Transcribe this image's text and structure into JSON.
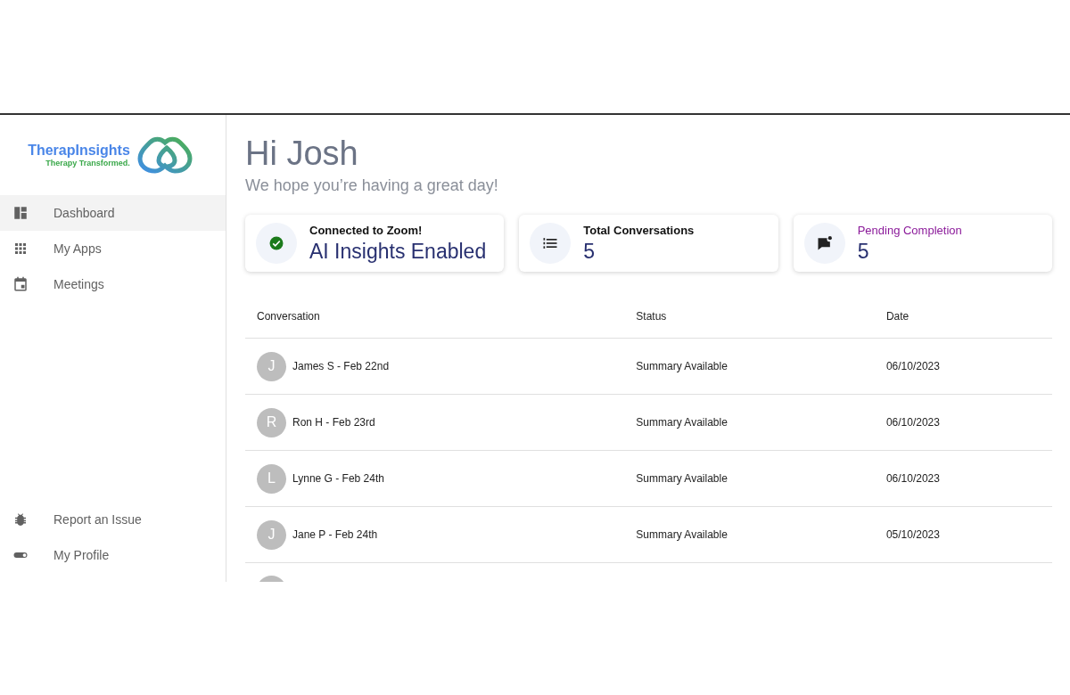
{
  "logo": {
    "name": "TherapInsights",
    "tagline": "Therapy Transformed."
  },
  "nav": [
    {
      "label": "Dashboard",
      "kind": "dashboard",
      "selected": true
    },
    {
      "label": "My Apps",
      "kind": "apps",
      "selected": false
    },
    {
      "label": "Meetings",
      "kind": "calendar",
      "selected": false
    }
  ],
  "nav_bottom": [
    {
      "label": "Report an Issue",
      "kind": "bug",
      "selected": false
    },
    {
      "label": "My Profile",
      "kind": "toggle",
      "selected": false
    }
  ],
  "greeting": {
    "title": "Hi Josh",
    "subtitle": "We hope you’re having a great day!"
  },
  "cards": [
    {
      "kind": "status",
      "title": "Connected to Zoom!",
      "value": "AI Insights Enabled",
      "highlighted": false
    },
    {
      "kind": "list",
      "title": "Total Conversations",
      "value": "5",
      "highlighted": false
    },
    {
      "kind": "flag",
      "title": "Pending Completion",
      "value": "5",
      "highlighted": true
    }
  ],
  "table": {
    "columns": [
      "Conversation",
      "Status",
      "Date"
    ],
    "rows": [
      {
        "initial": "J",
        "conversation": "James S - Feb 22nd",
        "status": "Summary Available",
        "date": "06/10/2023"
      },
      {
        "initial": "R",
        "conversation": "Ron H - Feb 23rd",
        "status": "Summary Available",
        "date": "06/10/2023"
      },
      {
        "initial": "L",
        "conversation": "Lynne G - Feb 24th",
        "status": "Summary Available",
        "date": "06/10/2023"
      },
      {
        "initial": "J",
        "conversation": "Jane P - Feb 24th",
        "status": "Summary Available",
        "date": "05/10/2023"
      }
    ]
  }
}
